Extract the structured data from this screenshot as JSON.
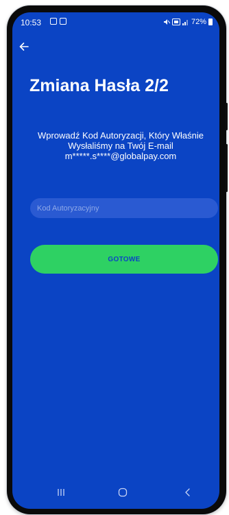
{
  "status_bar": {
    "time": "10:53",
    "battery_percent": "72%",
    "left_icons": [
      "gallery-notification-icon",
      "message-notification-icon"
    ],
    "right_icons": [
      "mute-icon",
      "volte-icon",
      "signal-icon",
      "battery-icon"
    ]
  },
  "header": {
    "title": "Zmiana Hasła 2/2"
  },
  "instructions": {
    "line1": "Wprowadź Kod Autoryzacji, Który Właśnie",
    "line2": "Wysłaliśmy na Twój E-mail",
    "email": "m*****.s****@globalpay.com"
  },
  "form": {
    "code_placeholder": "Kod Autoryzacyjny",
    "code_value": "",
    "submit_label": "GOTOWE"
  },
  "colors": {
    "background": "#0b44c4",
    "input_background": "#2a5ad2",
    "button": "#2ed163",
    "button_text": "#0b44c4",
    "text": "#ffffff"
  }
}
